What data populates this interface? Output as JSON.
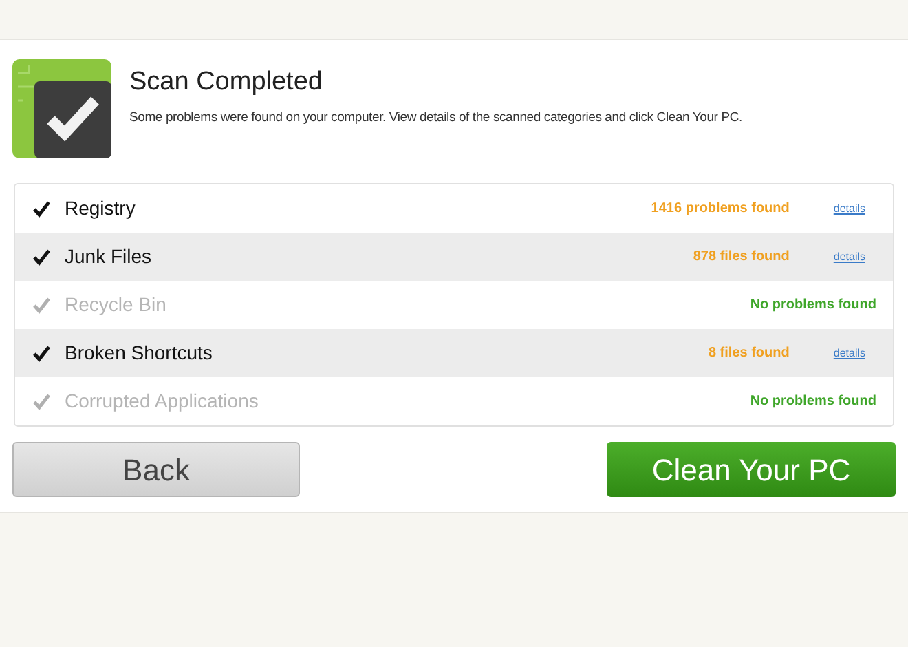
{
  "header": {
    "title": "Scan Completed",
    "subtitle": "Some problems were found on your computer. View details of the scanned categories and click Clean Your PC."
  },
  "categories": [
    {
      "name": "Registry",
      "checked": true,
      "disabled": false,
      "kind": "problems",
      "result": "1416 problems found",
      "link": "details"
    },
    {
      "name": "Junk Files",
      "checked": true,
      "disabled": false,
      "kind": "problems",
      "result": "878 files found",
      "link": "details"
    },
    {
      "name": "Recycle Bin",
      "checked": true,
      "disabled": true,
      "kind": "clean",
      "result": "No problems found"
    },
    {
      "name": "Broken Shortcuts",
      "checked": true,
      "disabled": false,
      "kind": "problems",
      "result": "8 files found",
      "link": "details"
    },
    {
      "name": "Corrupted Applications",
      "checked": true,
      "disabled": true,
      "kind": "clean",
      "result": "No problems found"
    }
  ],
  "buttons": {
    "back": "Back",
    "clean": "Clean Your PC"
  }
}
